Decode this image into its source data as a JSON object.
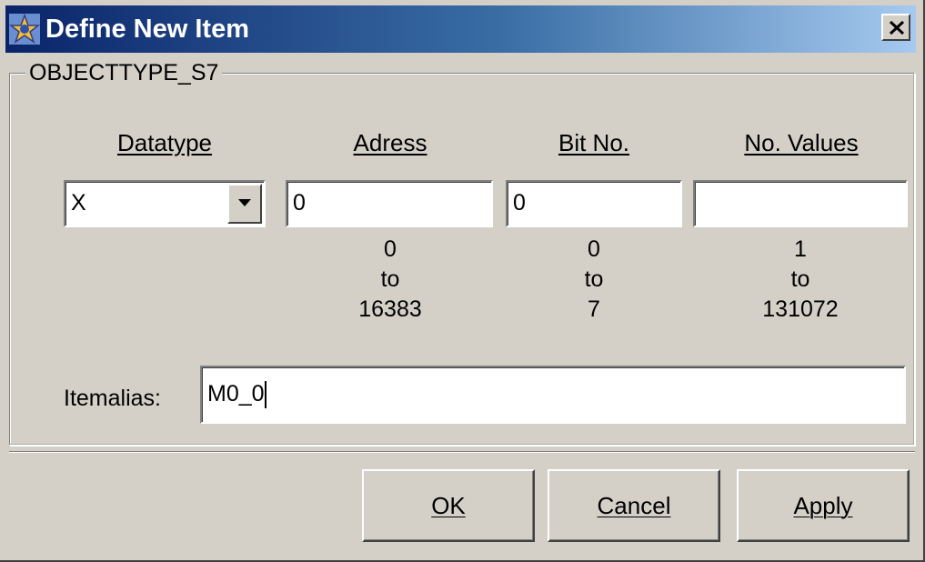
{
  "window": {
    "title": "Define New Item"
  },
  "group": {
    "label": "OBJECTTYPE_S7"
  },
  "columns": {
    "datatype": {
      "label": "Datatype",
      "value": "X"
    },
    "address": {
      "label": "Adress",
      "value": "0",
      "range": [
        "0",
        "to",
        "16383"
      ]
    },
    "bit": {
      "label": "Bit No.",
      "value": "0",
      "range": [
        "0",
        "to",
        "7"
      ]
    },
    "values": {
      "label": "No. Values",
      "value": "",
      "range": [
        "1",
        "to",
        "131072"
      ]
    }
  },
  "alias": {
    "label": "Itemalias:",
    "value": "M0_0"
  },
  "buttons": {
    "ok": "OK",
    "cancel": "Cancel",
    "apply": "Apply"
  },
  "colors": {
    "titlebar_start": "#0a246a",
    "titlebar_end": "#a6caf0",
    "face": "#d4d0c8"
  },
  "icons": {
    "app": "gear-star-icon",
    "close": "close-icon",
    "dropdown": "chevron-down-icon"
  }
}
